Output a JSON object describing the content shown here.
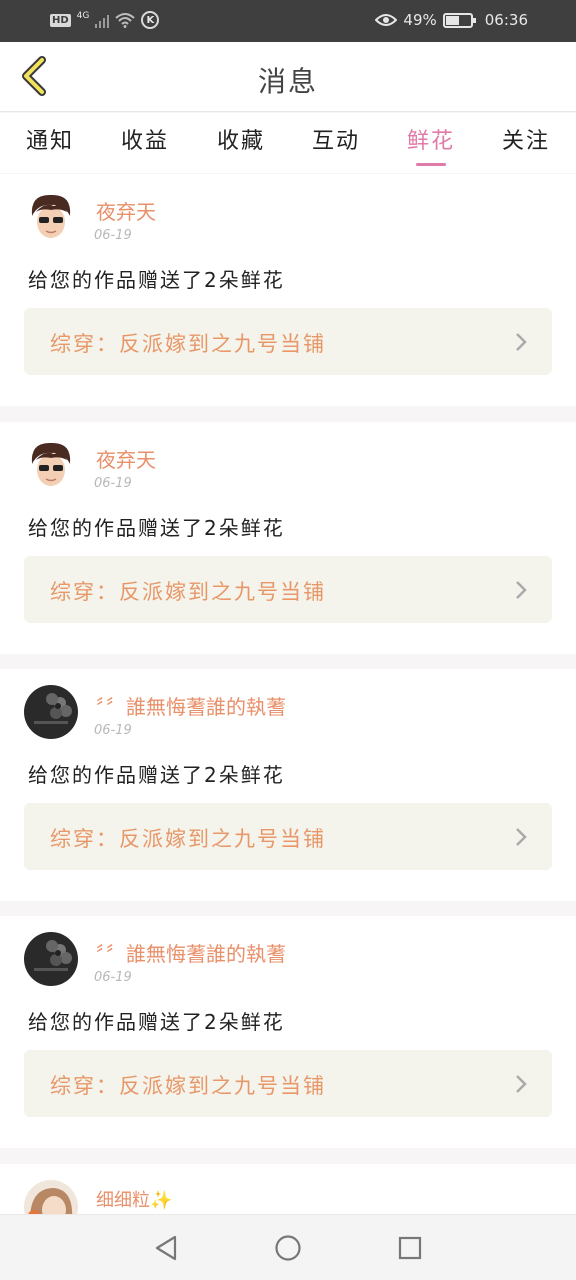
{
  "status_bar": {
    "hd": "HD",
    "network": "4G",
    "nfc": "K",
    "battery_percent": "49%",
    "battery_level": 0.49,
    "time": "06:36"
  },
  "header": {
    "title": "消息"
  },
  "tabs": [
    {
      "label": "通知"
    },
    {
      "label": "收益"
    },
    {
      "label": "收藏"
    },
    {
      "label": "互动"
    },
    {
      "label": "鲜花",
      "active": true
    },
    {
      "label": "关注"
    }
  ],
  "messages": [
    {
      "username": "夜弃天",
      "date": "06-19",
      "message": "给您的作品赠送了2朵鲜花",
      "work_title": "综穿：反派嫁到之九号当铺",
      "avatar": "cartoon-man-avatar"
    },
    {
      "username": "夜弃天",
      "date": "06-19",
      "message": "给您的作品赠送了2朵鲜花",
      "work_title": "综穿：反派嫁到之九号当铺",
      "avatar": "cartoon-man-avatar"
    },
    {
      "username": "〞〞誰無悔蓍誰的執蓍",
      "date": "06-19",
      "message": "给您的作品赠送了2朵鲜花",
      "work_title": "综穿：反派嫁到之九号当铺",
      "avatar": "dark-flower-avatar"
    },
    {
      "username": "〞〞誰無悔蓍誰的執蓍",
      "date": "06-19",
      "message": "给您的作品赠送了2朵鲜花",
      "work_title": "综穿：反派嫁到之九号当铺",
      "avatar": "dark-flower-avatar"
    },
    {
      "username": "细细粒✨",
      "date": "",
      "message": "",
      "work_title": "",
      "avatar": "girl-avatar"
    }
  ],
  "colors": {
    "accent": "#e07aa8",
    "username": "#e8906a",
    "work_link_text": "#e89868",
    "work_link_bg": "#f4f3ec"
  }
}
